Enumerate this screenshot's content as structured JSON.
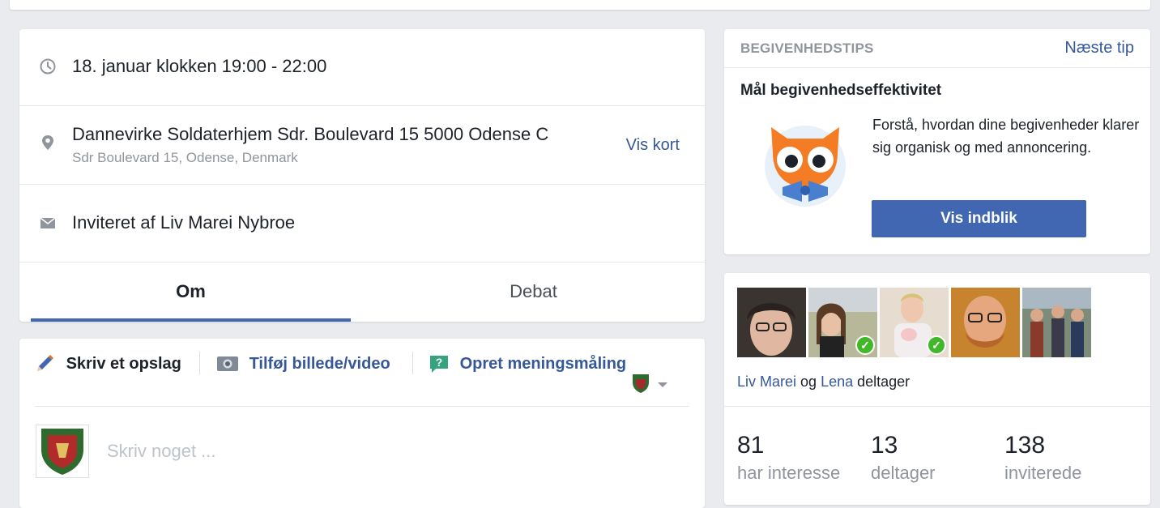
{
  "event": {
    "time": "18. januar klokken 19:00 - 22:00",
    "place_name": "Dannevirke Soldaterhjem Sdr. Boulevard 15 5000 Odense C",
    "place_address": "Sdr Boulevard 15, Odense, Denmark",
    "map_link": "Vis kort",
    "invited_prefix": "Inviteret af ",
    "invited_by": "Liv Marei Nybroe"
  },
  "tabs": [
    {
      "label": "Om",
      "active": true
    },
    {
      "label": "Debat",
      "active": false
    }
  ],
  "composer": {
    "write_post": "Skriv et opslag",
    "add_media": "Tilføj billede/video",
    "create_poll": "Opret meningsmåling",
    "placeholder": "Skriv noget ..."
  },
  "tips": {
    "header": "BEGIVENHEDSTIPS",
    "next": "Næste tip",
    "title": "Mål begivenhedseffektivitet",
    "description": "Forstå, hvordan dine begivenheder klarer sig organisk og med annoncering.",
    "button": "Vis indblik"
  },
  "attendees": {
    "name1": "Liv Marei",
    "conjunction": " og ",
    "name2": "Lena",
    "suffix": " deltager",
    "stats": [
      {
        "value": "81",
        "label": "har interesse"
      },
      {
        "value": "13",
        "label": "deltager"
      },
      {
        "value": "138",
        "label": "inviterede"
      }
    ]
  },
  "colors": {
    "accent": "#4267b2",
    "link": "#365899",
    "background": "#e9ebee",
    "check": "#42b72a"
  }
}
